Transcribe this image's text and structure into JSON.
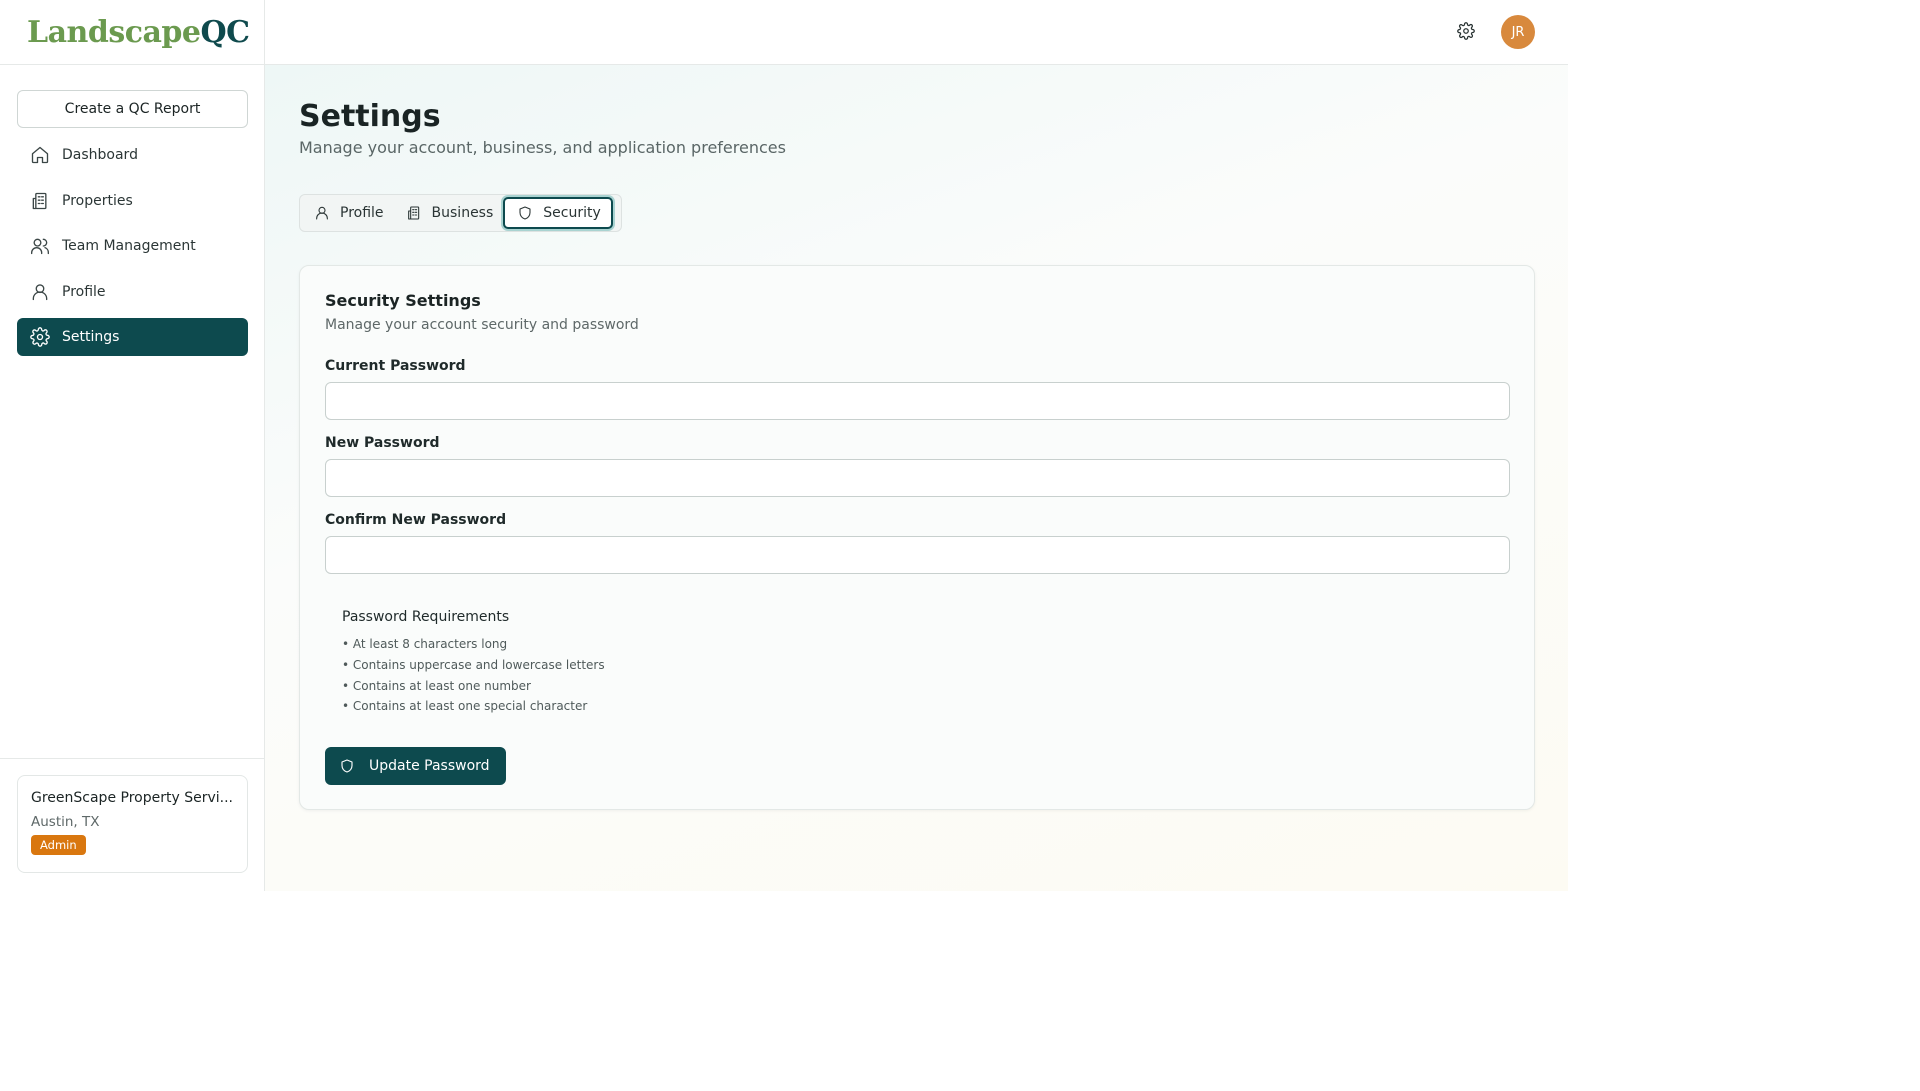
{
  "app": {
    "logo_part1": "Landscape",
    "logo_part2": "QC"
  },
  "sidebar": {
    "create_button": "Create a QC Report",
    "items": [
      {
        "label": "Dashboard",
        "icon": "home-icon"
      },
      {
        "label": "Properties",
        "icon": "building-icon"
      },
      {
        "label": "Team Management",
        "icon": "users-icon"
      },
      {
        "label": "Profile",
        "icon": "user-icon"
      },
      {
        "label": "Settings",
        "icon": "gear-icon",
        "active": true
      }
    ],
    "business": {
      "name": "GreenScape Property Servi...",
      "location": "Austin, TX",
      "role": "Admin"
    }
  },
  "topbar": {
    "avatar_initials": "JR"
  },
  "page": {
    "title": "Settings",
    "subtitle": "Manage your account, business, and application preferences"
  },
  "tabs": [
    {
      "label": "Profile",
      "icon": "user-icon"
    },
    {
      "label": "Business",
      "icon": "building-icon"
    },
    {
      "label": "Security",
      "icon": "shield-icon",
      "active": true
    }
  ],
  "security": {
    "title": "Security Settings",
    "subtitle": "Manage your account security and password",
    "current_password_label": "Current Password",
    "new_password_label": "New Password",
    "confirm_password_label": "Confirm New Password",
    "current_password_value": "",
    "new_password_value": "",
    "confirm_password_value": "",
    "requirements_title": "Password Requirements",
    "requirements": [
      "• At least 8 characters long",
      "• Contains uppercase and lowercase letters",
      "• Contains at least one number",
      "• Contains at least one special character"
    ],
    "update_button": "Update Password"
  },
  "colors": {
    "primary": "#0d4a4e",
    "logo_green": "#6b9a4f",
    "badge": "#d9770f",
    "avatar": "#d8893d"
  }
}
